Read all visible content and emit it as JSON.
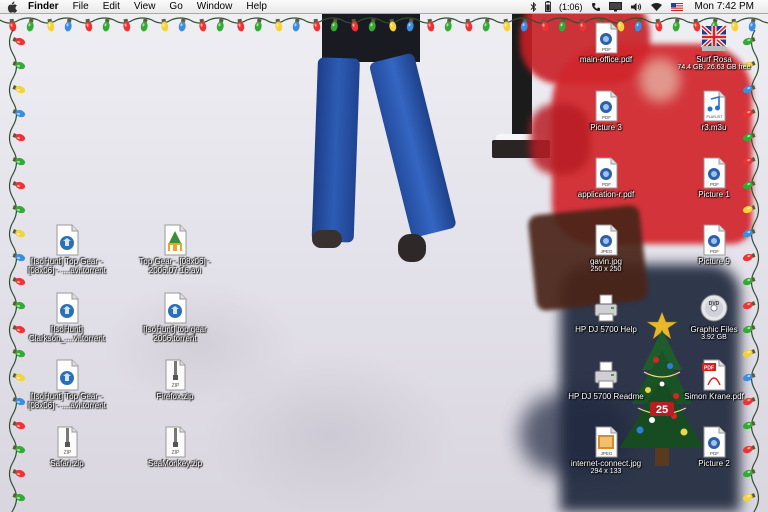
{
  "menubar": {
    "app": "Finder",
    "menus": [
      "File",
      "Edit",
      "View",
      "Go",
      "Window",
      "Help"
    ],
    "battery": "(1:06)",
    "clock": "Mon 7:42 PM"
  },
  "desktop": {
    "icons_left": [
      {
        "label": "[IsoHunt] Top Gear - [08x06] - ....avi.torrent",
        "type": "torrent-icon"
      },
      {
        "label": "[IsoHunt] Clarkson_....vi.torrent",
        "type": "torrent-icon"
      },
      {
        "label": "[IsoHunt] Top Gear - [08x06] - ....avi.torrent",
        "type": "torrent-icon"
      },
      {
        "label": "Safari.zip",
        "type": "zip-icon"
      }
    ],
    "icons_mid": [
      {
        "label": "Top Gear - [08x06] - 2006.07.16.avi",
        "type": "movie-icon"
      },
      {
        "label": "[IsoHunt] top gear 2006.torrent",
        "type": "torrent-icon"
      },
      {
        "label": "Firefox.zip",
        "type": "zip-icon"
      },
      {
        "label": "SeaMonkey.zip",
        "type": "zip-icon"
      }
    ],
    "icons_col3": [
      {
        "label": "main-office.pdf",
        "sub": "",
        "type": "pdf-icon"
      },
      {
        "label": "Picture 3",
        "sub": "",
        "type": "pdf-icon"
      },
      {
        "label": "application-r.pdf",
        "sub": "",
        "type": "pdf-icon"
      },
      {
        "label": "gavin.jpg",
        "sub": "250 x 250",
        "type": "jpeg-icon"
      },
      {
        "label": "HP DJ 5700 Help",
        "sub": "",
        "type": "printer-icon"
      },
      {
        "label": "HP DJ 5700 Readme",
        "sub": "",
        "type": "printer-icon"
      },
      {
        "label": "internet-connect.jpg",
        "sub": "294 x 133",
        "type": "jpeg-icon"
      }
    ],
    "icons_col4": [
      {
        "label": "Surf Rosa",
        "sub": "74.4 GB, 26.63 GB free",
        "type": "drive-icon"
      },
      {
        "label": "r3.m3u",
        "sub": "",
        "type": "playlist-icon"
      },
      {
        "label": "Picture 1",
        "sub": "",
        "type": "pdf-icon"
      },
      {
        "label": "Picture 9",
        "sub": "",
        "type": "pdf-icon"
      },
      {
        "label": "Graphic Files",
        "sub": "3.92 GB",
        "type": "dvd-icon"
      },
      {
        "label": "Simon Krane.pdf",
        "sub": "",
        "type": "pdf-red-icon"
      },
      {
        "label": "Picture 2",
        "sub": "",
        "type": "pdf-icon"
      }
    ],
    "tree_number": "25"
  }
}
